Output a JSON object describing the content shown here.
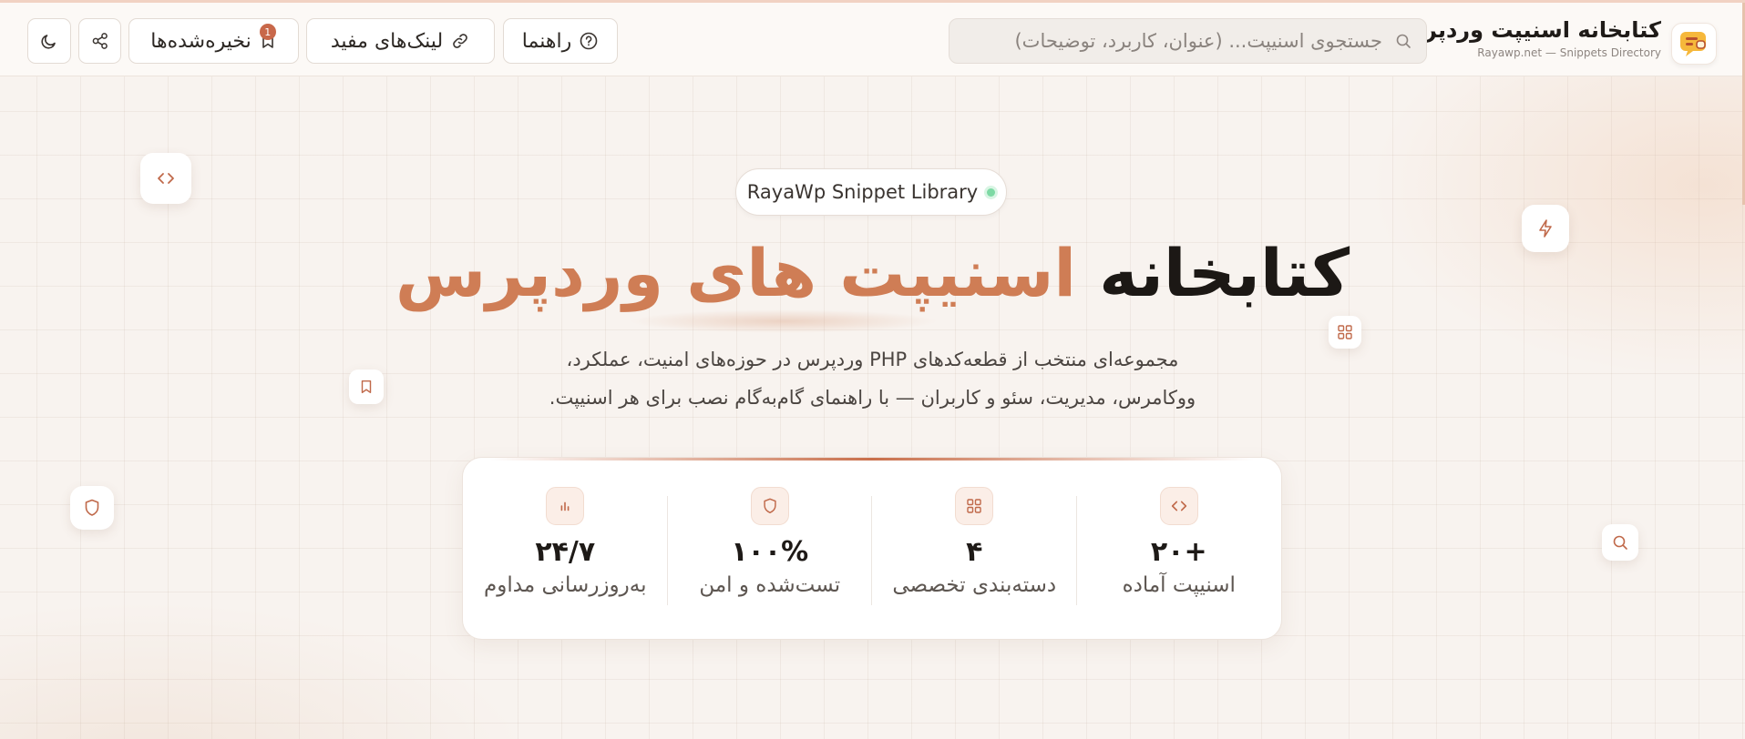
{
  "header": {
    "brand_title": "کتابخانه اسنیپت وردپرس",
    "brand_subtitle": "Rayawp.net — Snippets Directory",
    "search_placeholder": "جستجوی اسنیپت... (عنوان، کاربرد، توضیحات)",
    "guide_label": "راهنما",
    "links_label": "لینک‌های مفید",
    "saved_label": "نخیره‌شده‌ها",
    "saved_count": "1"
  },
  "hero": {
    "pill_label": "RayaWp Snippet Library",
    "title_dark": "کتابخانه",
    "title_accent": "اسنیپت های وردپرس",
    "description_line1": "مجموعه‌ای منتخب از قطعه‌کدهای PHP وردپرس در حوزه‌های امنیت، عملکرد،",
    "description_line2": "ووکامرس، مدیریت، سئو و کاربران — با راهنمای گام‌به‌گام نصب برای هر اسنیپت."
  },
  "stats": [
    {
      "icon": "code-icon",
      "value": "+۲۰",
      "label": "اسنیپت آماده"
    },
    {
      "icon": "grid-icon",
      "value": "۴",
      "label": "دسته‌بندی تخصصی"
    },
    {
      "icon": "shield-icon",
      "value": "۱۰۰%",
      "label": "تست‌شده و امن"
    },
    {
      "icon": "bar-chart-icon",
      "value": "۲۴/۷",
      "label": "به‌روزرسانی مداوم"
    }
  ],
  "colors": {
    "accent": "#cf7d55",
    "icon_accent": "#c0694a",
    "background": "#f8f3ef",
    "status_dot": "#7dd9a4"
  }
}
